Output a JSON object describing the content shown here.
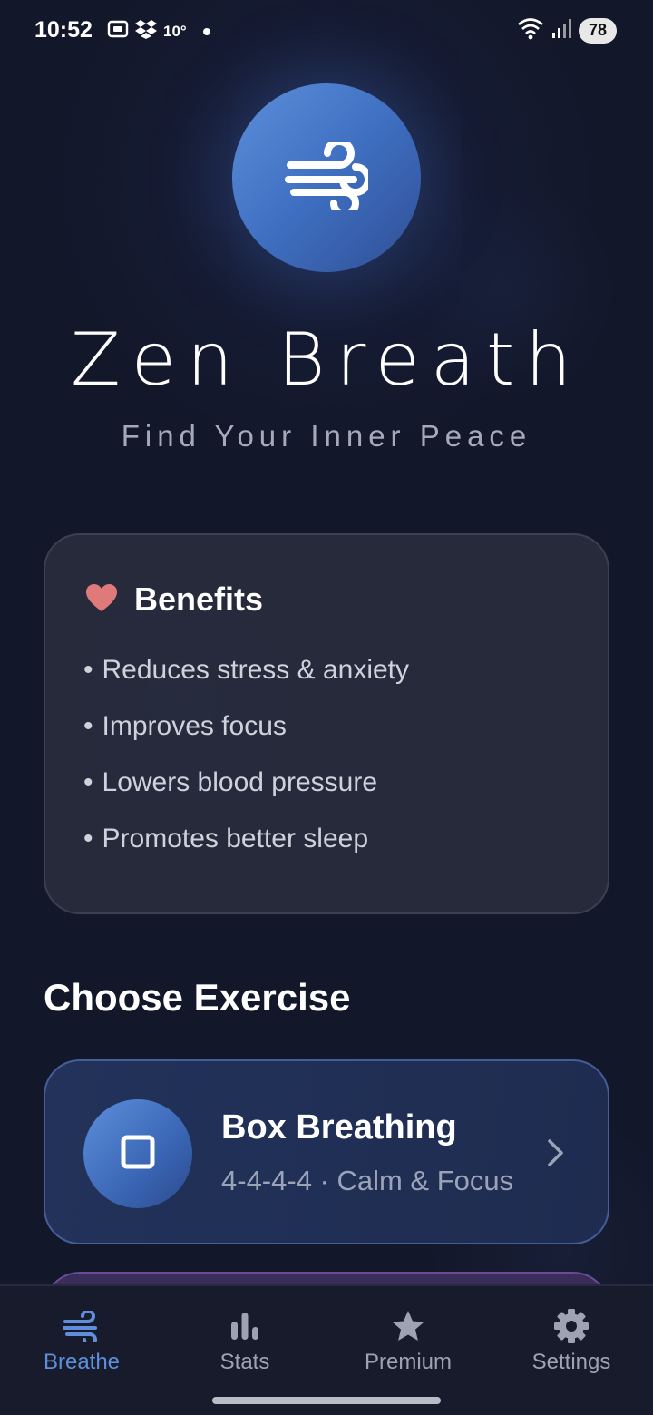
{
  "status_bar": {
    "time": "10:52",
    "temperature": "10°",
    "battery": "78",
    "icons": [
      "screenshot-icon",
      "dropbox-icon",
      "wifi-icon",
      "signal-icon"
    ]
  },
  "hero": {
    "icon": "wind-icon",
    "title": "Zen Breath",
    "subtitle": "Find Your Inner Peace"
  },
  "benefits": {
    "icon": "heart-icon",
    "title": "Benefits",
    "items": [
      "Reduces stress & anxiety",
      "Improves focus",
      "Lowers blood pressure",
      "Promotes better sleep"
    ]
  },
  "exercises": {
    "section_title": "Choose Exercise",
    "items": [
      {
        "icon": "square-icon",
        "name": "Box Breathing",
        "meta": "4-4-4-4 · Calm & Focus"
      }
    ]
  },
  "nav": {
    "items": [
      {
        "label": "Breathe",
        "icon": "wind-icon",
        "active": true
      },
      {
        "label": "Stats",
        "icon": "bar-chart-icon",
        "active": false
      },
      {
        "label": "Premium",
        "icon": "star-icon",
        "active": false
      },
      {
        "label": "Settings",
        "icon": "gear-icon",
        "active": false
      }
    ]
  },
  "colors": {
    "background": "#13172a",
    "accent": "#5f8fdc",
    "heart": "#e07a7a"
  }
}
